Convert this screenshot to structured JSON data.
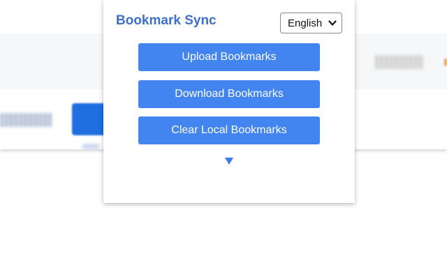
{
  "popup": {
    "title": "Bookmark Sync",
    "language_select": {
      "selected": "English"
    },
    "buttons": {
      "upload": "Upload Bookmarks",
      "download": "Download Bookmarks",
      "clear": "Clear Local Bookmarks"
    },
    "expand_icon": "triangle-down-icon"
  },
  "colors": {
    "title": "#3e6fcb",
    "button_bg": "#4385f0",
    "button_text": "#ffffff",
    "expand_arrow": "#3f7be8",
    "page_band": "#f6f7f9"
  }
}
